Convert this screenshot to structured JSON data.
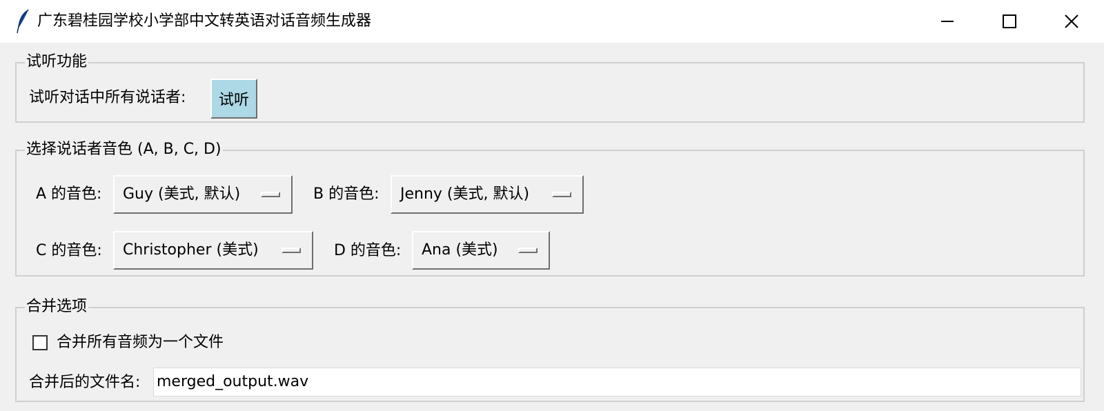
{
  "window": {
    "title": "广东碧桂园学校小学部中文转英语对话音频生成器",
    "icon": "feather-icon"
  },
  "preview": {
    "legend": "试听功能",
    "label": "试听对话中所有说话者:",
    "button_label": "试听",
    "button_color": "#add8e6"
  },
  "voices": {
    "legend": "选择说话者音色 (A, B, C, D)",
    "a_label": "A 的音色:",
    "a_value": "Guy (美式, 默认)",
    "b_label": "B 的音色:",
    "b_value": "Jenny (美式, 默认)",
    "c_label": "C 的音色:",
    "c_value": "Christopher (美式)",
    "d_label": "D 的音色:",
    "d_value": "Ana (美式)"
  },
  "merge": {
    "legend": "合并选项",
    "checkbox_label": "合并所有音频为一个文件",
    "checked": false,
    "filename_label": "合并后的文件名:",
    "filename_value": "merged_output.wav"
  }
}
